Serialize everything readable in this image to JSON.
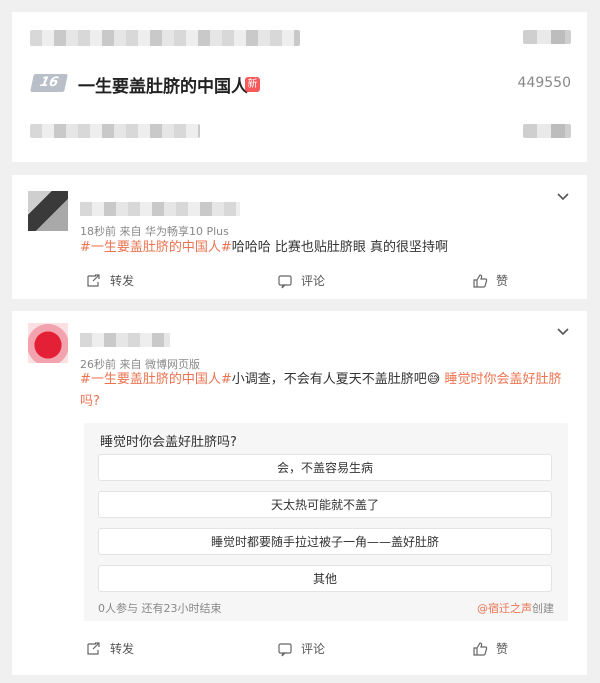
{
  "colors": {
    "accent": "#eb7350",
    "new_tag": "#f65a5a",
    "rank_badge": "#b9bfc9"
  },
  "topic": {
    "rank": "16",
    "title": "一生要盖肚脐的中国人",
    "new_tag": "新",
    "hot_count": "449550"
  },
  "posts": [
    {
      "meta": "18秒前  来自 华为畅享10 Plus",
      "hashtag": "#一生要盖肚脐的中国人#",
      "text": "哈哈哈 比赛也贴肚脐眼 真的很坚持啊",
      "actions": {
        "repost": "转发",
        "comment": "评论",
        "like": "赞"
      }
    },
    {
      "meta": "26秒前  来自 微博网页版",
      "hashtag": "#一生要盖肚脐的中国人#",
      "text": "小调查，不会有人夏天不盖肚脐吧😅",
      "link_line1": "睡觉时你会盖好肚脐",
      "link_line2": "吗?",
      "poll": {
        "question": "睡觉时你会盖好肚脐吗?",
        "options": [
          "会，不盖容易生病",
          "天太热可能就不盖了",
          "睡觉时都要随手拉过被子一角——盖好肚脐",
          "其他"
        ],
        "stats": "0人参与  还有23小时结束",
        "creator": "@宿迁之声",
        "creator_suffix": "创建"
      },
      "actions": {
        "repost": "转发",
        "comment": "评论",
        "like": "赞"
      }
    }
  ]
}
